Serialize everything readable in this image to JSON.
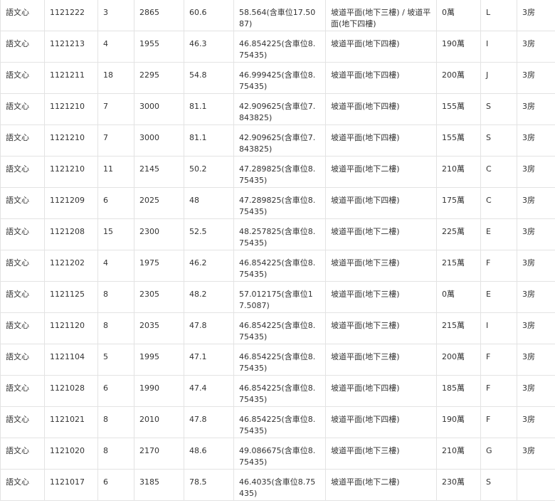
{
  "table": {
    "rows": [
      [
        "語文心",
        "1121222",
        "3",
        "2865",
        "60.6",
        "58.564(含車位17.5087)",
        "坡道平面(地下三樓) / 坡道平面(地下四樓)",
        "0萬",
        "L",
        "3房"
      ],
      [
        "語文心",
        "1121213",
        "4",
        "1955",
        "46.3",
        "46.854225(含車位8.75435)",
        "坡道平面(地下四樓)",
        "190萬",
        "I",
        "3房"
      ],
      [
        "語文心",
        "1121211",
        "18",
        "2295",
        "54.8",
        "46.999425(含車位8.75435)",
        "坡道平面(地下四樓)",
        "200萬",
        "J",
        "3房"
      ],
      [
        "語文心",
        "1121210",
        "7",
        "3000",
        "81.1",
        "42.909625(含車位7.843825)",
        "坡道平面(地下四樓)",
        "155萬",
        "S",
        "3房"
      ],
      [
        "語文心",
        "1121210",
        "7",
        "3000",
        "81.1",
        "42.909625(含車位7.843825)",
        "坡道平面(地下四樓)",
        "155萬",
        "S",
        "3房"
      ],
      [
        "語文心",
        "1121210",
        "11",
        "2145",
        "50.2",
        "47.289825(含車位8.75435)",
        "坡道平面(地下二樓)",
        "210萬",
        "C",
        "3房"
      ],
      [
        "語文心",
        "1121209",
        "6",
        "2025",
        "48",
        "47.289825(含車位8.75435)",
        "坡道平面(地下四樓)",
        "175萬",
        "C",
        "3房"
      ],
      [
        "語文心",
        "1121208",
        "15",
        "2300",
        "52.5",
        "48.257825(含車位8.75435)",
        "坡道平面(地下二樓)",
        "225萬",
        "E",
        "3房"
      ],
      [
        "語文心",
        "1121202",
        "4",
        "1975",
        "46.2",
        "46.854225(含車位8.75435)",
        "坡道平面(地下三樓)",
        "215萬",
        "F",
        "3房"
      ],
      [
        "語文心",
        "1121125",
        "8",
        "2305",
        "48.2",
        "57.012175(含車位17.5087)",
        "坡道平面(地下三樓)",
        "0萬",
        "E",
        "3房"
      ],
      [
        "語文心",
        "1121120",
        "8",
        "2035",
        "47.8",
        "46.854225(含車位8.75435)",
        "坡道平面(地下三樓)",
        "215萬",
        "I",
        "3房"
      ],
      [
        "語文心",
        "1121104",
        "5",
        "1995",
        "47.1",
        "46.854225(含車位8.75435)",
        "坡道平面(地下三樓)",
        "200萬",
        "F",
        "3房"
      ],
      [
        "語文心",
        "1121028",
        "6",
        "1990",
        "47.4",
        "46.854225(含車位8.75435)",
        "坡道平面(地下四樓)",
        "185萬",
        "F",
        "3房"
      ],
      [
        "語文心",
        "1121021",
        "8",
        "2010",
        "47.8",
        "46.854225(含車位8.75435)",
        "坡道平面(地下四樓)",
        "190萬",
        "F",
        "3房"
      ],
      [
        "語文心",
        "1121020",
        "8",
        "2170",
        "48.6",
        "49.086675(含車位8.75435)",
        "坡道平面(地下三樓)",
        "210萬",
        "G",
        "3房"
      ],
      [
        "語文心",
        "1121017",
        "6",
        "3185",
        "78.5",
        "46.4035(含車位8.75435)",
        "坡道平面(地下二樓)",
        "230萬",
        "S",
        ""
      ]
    ]
  }
}
